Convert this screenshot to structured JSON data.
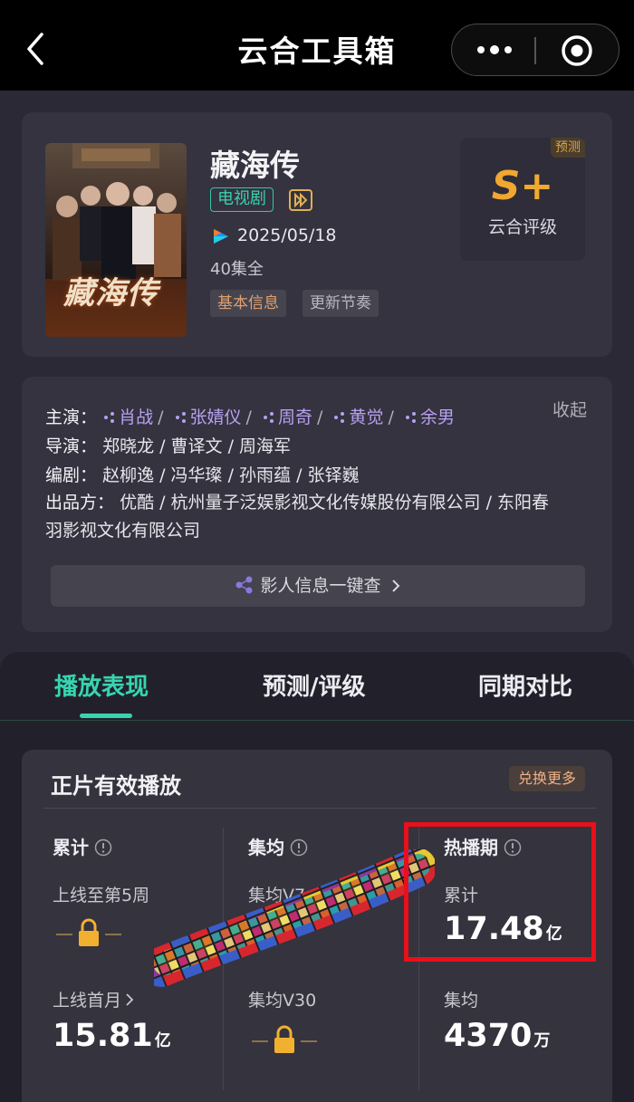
{
  "nav": {
    "title": "云合工具箱"
  },
  "show": {
    "poster_title": "藏海传",
    "title": "藏海传",
    "type": "电视剧",
    "date": "2025/05/18",
    "episodes": "40集全",
    "tags": [
      "基本信息",
      "更新节奏"
    ],
    "rating": {
      "badge": "预测",
      "grade": "S+",
      "label": "云合评级"
    }
  },
  "credits": {
    "collapse": "收起",
    "cast_label": "主演：",
    "cast": [
      "肖战",
      "张婧仪",
      "周奇",
      "黄觉",
      "余男"
    ],
    "director_label": "导演：",
    "directors": "郑晓龙 / 曹译文 / 周海军",
    "writer_label": "编剧：",
    "writers": "赵柳逸 / 冯华璨 / 孙雨蕴 / 张铎巍",
    "producer_label": "出品方：",
    "producers_line1": "优酷 / 杭州量子泛娱影视文化传媒股份有限公司 / 东阳春",
    "producers_line2": "羽影视文化有限公司",
    "lookup": "影人信息一键查"
  },
  "tabs": [
    "播放表现",
    "预测/评级",
    "同期对比"
  ],
  "stats": {
    "title": "正片有效播放",
    "switch": "兑换更多",
    "col1": {
      "header": "累计",
      "sub1": "上线至第5周",
      "sub2": "上线首月",
      "value2": "15.81",
      "unit2": "亿"
    },
    "col2": {
      "header": "集均",
      "sub1": "集均V7",
      "sub2": "集均V30"
    },
    "col3": {
      "header": "热播期",
      "sub1": "累计",
      "value1": "17.48",
      "unit1": "亿",
      "sub2": "集均",
      "value2": "4370",
      "unit2": "万"
    }
  }
}
